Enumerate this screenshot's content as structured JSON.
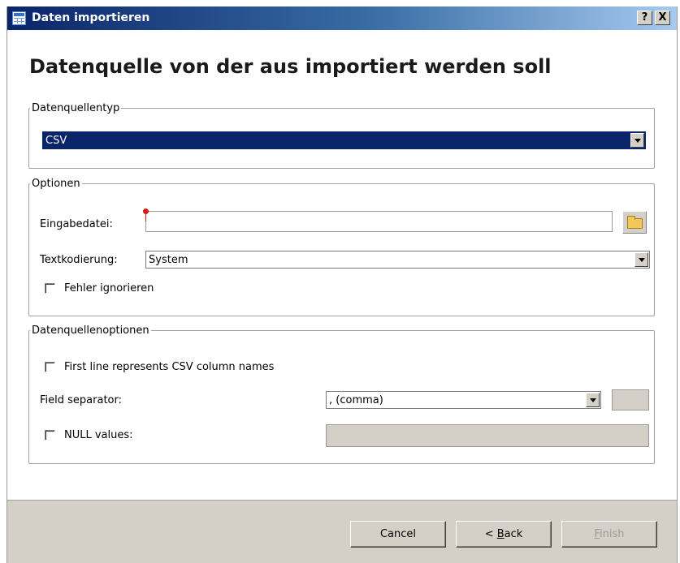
{
  "window": {
    "title": "Daten importieren",
    "help_button": "?",
    "close_button": "X"
  },
  "heading": "Datenquelle von der aus importiert werden soll",
  "source_type_group": {
    "legend": "Datenquellentyp",
    "selected": "CSV"
  },
  "options_group": {
    "legend": "Optionen",
    "input_file_label": "Eingabedatei:",
    "input_file_value": "",
    "encoding_label": "Textkodierung:",
    "encoding_value": "System",
    "ignore_errors_label": "Fehler ignorieren",
    "ignore_errors_checked": false
  },
  "source_options_group": {
    "legend": "Datenquellenoptionen",
    "first_line_label": "First line represents CSV column names",
    "first_line_checked": false,
    "separator_label": "Field separator:",
    "separator_value": ", (comma)",
    "null_values_label": "NULL values:",
    "null_values_checked": false
  },
  "footer": {
    "cancel": "Cancel",
    "back_prefix": "< ",
    "back_mnemonic": "B",
    "back_rest": "ack",
    "finish_mnemonic": "F",
    "finish_rest": "inish"
  },
  "colors": {
    "selection": "#0a246a",
    "dialog_bg": "#d4d0c8",
    "error_marker": "#d8191a"
  }
}
